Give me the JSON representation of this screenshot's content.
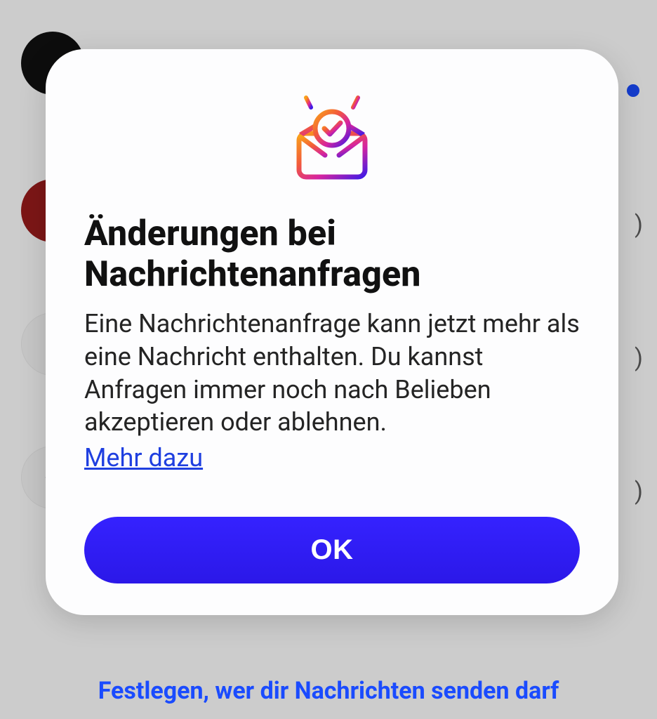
{
  "background": {
    "bottom_link": "Festlegen, wer dir Nachrichten senden darf"
  },
  "modal": {
    "title": "Änderungen bei Nachrichtenanfragen",
    "body": "Eine Nachrichtenanfrage kann jetzt mehr als eine Nachricht enthalten. Du kannst Anfragen immer noch nach Belieben akzeptieren oder ablehnen.",
    "learn_more": "Mehr dazu",
    "ok_label": "OK"
  },
  "colors": {
    "primary_button": "#2e1fe0",
    "link": "#1f3fe0"
  }
}
